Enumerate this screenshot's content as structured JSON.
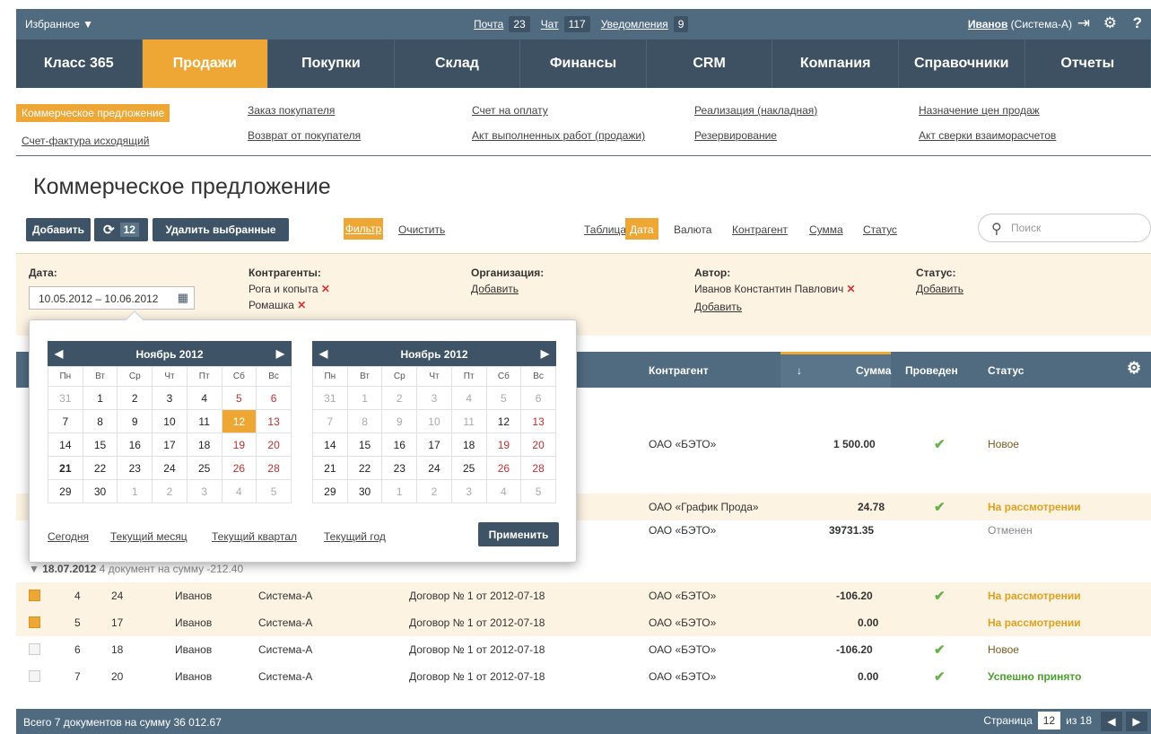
{
  "topbar": {
    "favorites": "Избранное ▼",
    "mail_label": "Почта",
    "mail_count": "23",
    "chat_label": "Чат",
    "chat_count": "117",
    "notif_label": "Уведомления",
    "notif_count": "9",
    "user": "Иванов",
    "system": "(Система-А)"
  },
  "mainnav": [
    "Класс 365",
    "Продажи",
    "Покупки",
    "Склад",
    "Финансы",
    "CRM",
    "Компания",
    "Справочники",
    "Отчеты"
  ],
  "subnav": {
    "col1": [
      "Коммерческое предложение",
      "Счет-фактура исходящий"
    ],
    "col2": [
      "Заказ покупателя",
      "Возврат от покупателя"
    ],
    "col3": [
      "Счет на оплату",
      "Акт выполненных работ (продажи)"
    ],
    "col4": [
      "Реализация (накладная)",
      "Резервирование"
    ],
    "col5": [
      "Назначение цен продаж",
      "Акт сверки взаиморасчетов"
    ]
  },
  "page_title": "Коммерческое предложение",
  "toolbar": {
    "add": "Добавить",
    "refresh_count": "12",
    "delete": "Удалить выбранные",
    "filter": "Фильтр",
    "clear": "Очистить",
    "table": "Таблица",
    "date": "Дата",
    "currency": "Валюта",
    "counterparty": "Контрагент",
    "sum": "Сумма",
    "status": "Статус",
    "search_placeholder": "Поиск"
  },
  "filter": {
    "date_label": "Дата:",
    "date_value": "10.05.2012 – 10.06.2012",
    "contr_label": "Контрагенты:",
    "contr1": "Рога и копыта",
    "contr2": "Ромашка",
    "org_label": "Организация:",
    "org_add": "Добавить",
    "author_label": "Автор:",
    "author_value": "Иванов Константин Павлович",
    "author_add": "Добавить",
    "status_label": "Статус:",
    "status_add": "Добавить"
  },
  "calendar": {
    "left_title": "Ноябрь 2012",
    "right_title": "Ноябрь 2012",
    "weekdays": [
      "Пн",
      "Вт",
      "Ср",
      "Чт",
      "Пт",
      "Сб",
      "Вс"
    ],
    "quick": [
      "Сегодня",
      "Текущий месяц",
      "Текущий квартал",
      "Текущий год"
    ],
    "apply": "Применить"
  },
  "grid": {
    "headers": {
      "contr": "Контрагент",
      "sort": "↓",
      "sum": "Сумма",
      "posted": "Проведен",
      "status": "Статус"
    },
    "top_rows": [
      {
        "contr": "ОАО «БЭТО»",
        "sum": "1 500.00",
        "posted": "✔",
        "status": "Новое"
      },
      {
        "contr": "ОАО «График Прода»",
        "sum": "24.78",
        "posted": "✔",
        "status": "На рассмотрении"
      },
      {
        "contr": "ОАО «БЭТО»",
        "sum": "39731.35",
        "posted": "",
        "status": "Отменен"
      }
    ],
    "group": {
      "date": "18.07.2012",
      "text": "4 документ на сумму -212.40"
    },
    "rows": [
      {
        "n": "4",
        "num": "24",
        "author": "Иванов",
        "org": "Система-А",
        "contract": "Договор № 1 от 2012-07-18",
        "contr": "ОАО «БЭТО»",
        "sum": "-106.20",
        "posted": "✔",
        "status": "На рассмотрении"
      },
      {
        "n": "5",
        "num": "17",
        "author": "Иванов",
        "org": "Система-А",
        "contract": "Договор № 1 от 2012-07-18",
        "contr": "ОАО «БЭТО»",
        "sum": "0.00",
        "posted": "",
        "status": "На рассмотрении"
      },
      {
        "n": "6",
        "num": "18",
        "author": "Иванов",
        "org": "Система-А",
        "contract": "Договор № 1 от 2012-07-18",
        "contr": "ОАО «БЭТО»",
        "sum": "-106.20",
        "posted": "✔",
        "status": "Новое"
      },
      {
        "n": "7",
        "num": "20",
        "author": "Иванов",
        "org": "Система-А",
        "contract": "Договор № 1 от 2012-07-18",
        "contr": "ОАО «БЭТО»",
        "sum": "0.00",
        "posted": "✔",
        "status": "Успешно принято"
      }
    ]
  },
  "footer": {
    "summary": "Всего 7 документов на сумму 36 012.67",
    "page_label": "Страница",
    "page": "12",
    "of": "из 18"
  }
}
